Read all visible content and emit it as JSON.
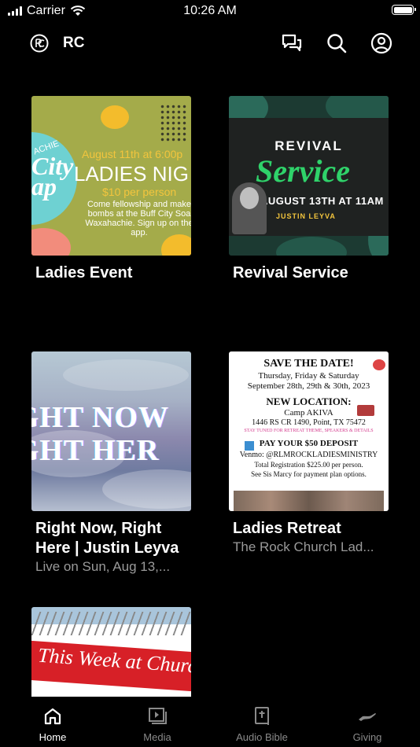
{
  "status_bar": {
    "carrier": "Carrier",
    "time": "10:26 AM"
  },
  "header": {
    "brand": "RC",
    "icons": [
      "rc-logo-icon",
      "chat-icon",
      "search-icon",
      "profile-icon"
    ]
  },
  "cards": [
    {
      "title": "Ladies Event",
      "subtitle": "",
      "image_text": {
        "line1": "August 11th at 6:00p",
        "line2": "LADIES NIG",
        "line3": "$10 per person",
        "line4": "Come fellowship and make bombs at the Buff City Soa Waxahachie. Sign up on the app.",
        "circle_top": "ACHIE",
        "circle_main": "City ap"
      }
    },
    {
      "title": "Revival Service",
      "subtitle": "",
      "image_text": {
        "line1": "REVIVAL",
        "line2": "Service",
        "line3": "AUGUST 13TH AT 11AM",
        "line4": "JUSTIN LEYVA"
      }
    },
    {
      "title": "Right Now, Right Here | Justin Leyva",
      "subtitle": "Live on Sun, Aug 13,...",
      "image_text": {
        "line1": "IGHT NOW",
        "line2": "IGHT HER"
      }
    },
    {
      "title": "Ladies Retreat",
      "subtitle": "The Rock Church Lad...",
      "image_text": {
        "l1": "SAVE THE DATE!",
        "l2": "Thursday, Friday & Saturday",
        "l3": "September 28th, 29th & 30th, 2023",
        "l4": "NEW LOCATION:",
        "l5": "Camp AKIVA",
        "l6": "1446 RS CR 1490, Point, TX 75472",
        "l7": "STAY TUNED FOR RETREAT THEME, SPEAKERS & DETAILS",
        "l8": "PAY YOUR $50 DEPOSIT",
        "l9": "Venmo: @RLMROCKLADIESMINISTRY",
        "l10": "Total Registration $225.00 per person.",
        "l11": "See Sis Marcy for payment plan options."
      }
    },
    {
      "title": "",
      "subtitle": "",
      "image_text": {
        "line1": "This Week at Church"
      }
    }
  ],
  "tabs": [
    {
      "label": "Home",
      "icon": "home-icon",
      "active": true
    },
    {
      "label": "Media",
      "icon": "media-icon",
      "active": false
    },
    {
      "label": "Audio Bible",
      "icon": "bible-icon",
      "active": false
    },
    {
      "label": "Giving",
      "icon": "giving-icon",
      "active": false
    }
  ],
  "colors": {
    "background": "#000000",
    "text": "#ffffff",
    "muted": "#9a9a9a",
    "tab_inactive": "#8a8a8a"
  }
}
